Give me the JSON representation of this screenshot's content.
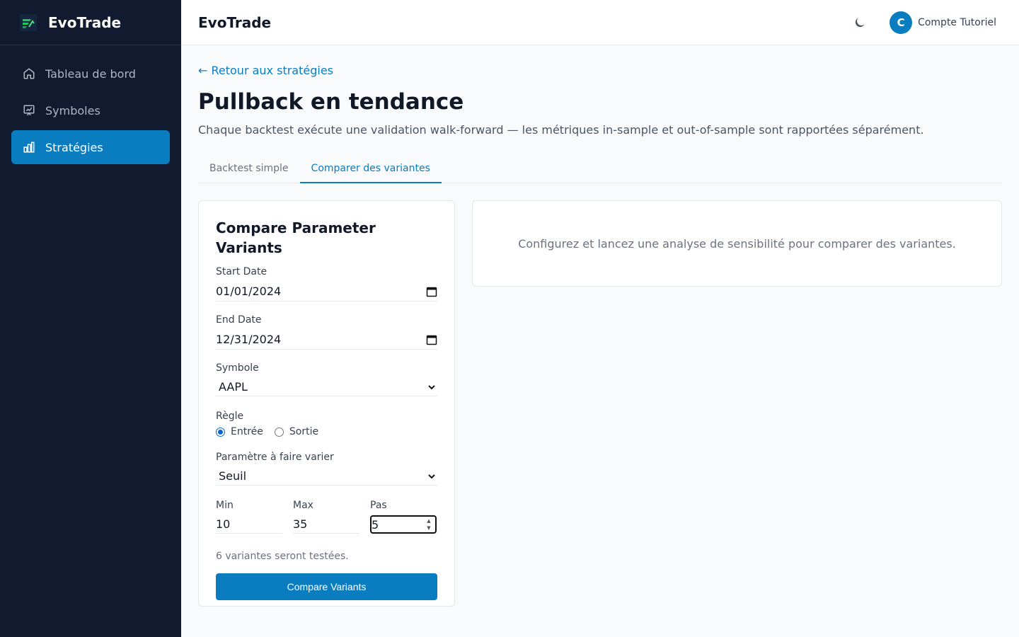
{
  "app": {
    "name": "EvoTrade"
  },
  "sidebar": {
    "items": [
      {
        "label": "Tableau de bord",
        "icon": "home-icon",
        "active": false
      },
      {
        "label": "Symboles",
        "icon": "chart-board-icon",
        "active": false
      },
      {
        "label": "Stratégies",
        "icon": "bar-chart-icon",
        "active": true
      }
    ]
  },
  "header": {
    "title": "EvoTrade",
    "theme_icon": "moon-icon",
    "avatar_initial": "C",
    "account_name": "Compte Tutoriel"
  },
  "main": {
    "back_link": "← Retour aux stratégies",
    "title": "Pullback en tendance",
    "description": "Chaque backtest exécute une validation walk-forward — les métriques in-sample et out-of-sample sont rapportées séparément.",
    "tabs": [
      {
        "label": "Backtest simple",
        "active": false
      },
      {
        "label": "Comparer des variantes",
        "active": true
      }
    ]
  },
  "form": {
    "title": "Compare Parameter Variants",
    "start_date_label": "Start Date",
    "start_date_value": "01/01/2024",
    "end_date_label": "End Date",
    "end_date_value": "12/31/2024",
    "symbol_label": "Symbole",
    "symbol_value": "AAPL",
    "rule_label": "Règle",
    "rule_options": [
      {
        "label": "Entrée",
        "checked": true
      },
      {
        "label": "Sortie",
        "checked": false
      }
    ],
    "param_label": "Paramètre à faire varier",
    "param_value": "Seuil",
    "min_label": "Min",
    "min_value": "10",
    "max_label": "Max",
    "max_value": "35",
    "step_label": "Pas",
    "step_value": "5",
    "hint": "6 variantes seront testées.",
    "submit_label": "Compare Variants"
  },
  "results": {
    "empty_text": "Configurez et lancez une analyse de sensibilité pour comparer des variantes."
  },
  "colors": {
    "sidebar_bg": "#111a2e",
    "accent": "#0a7cc0",
    "page_bg": "#f8fafc"
  }
}
